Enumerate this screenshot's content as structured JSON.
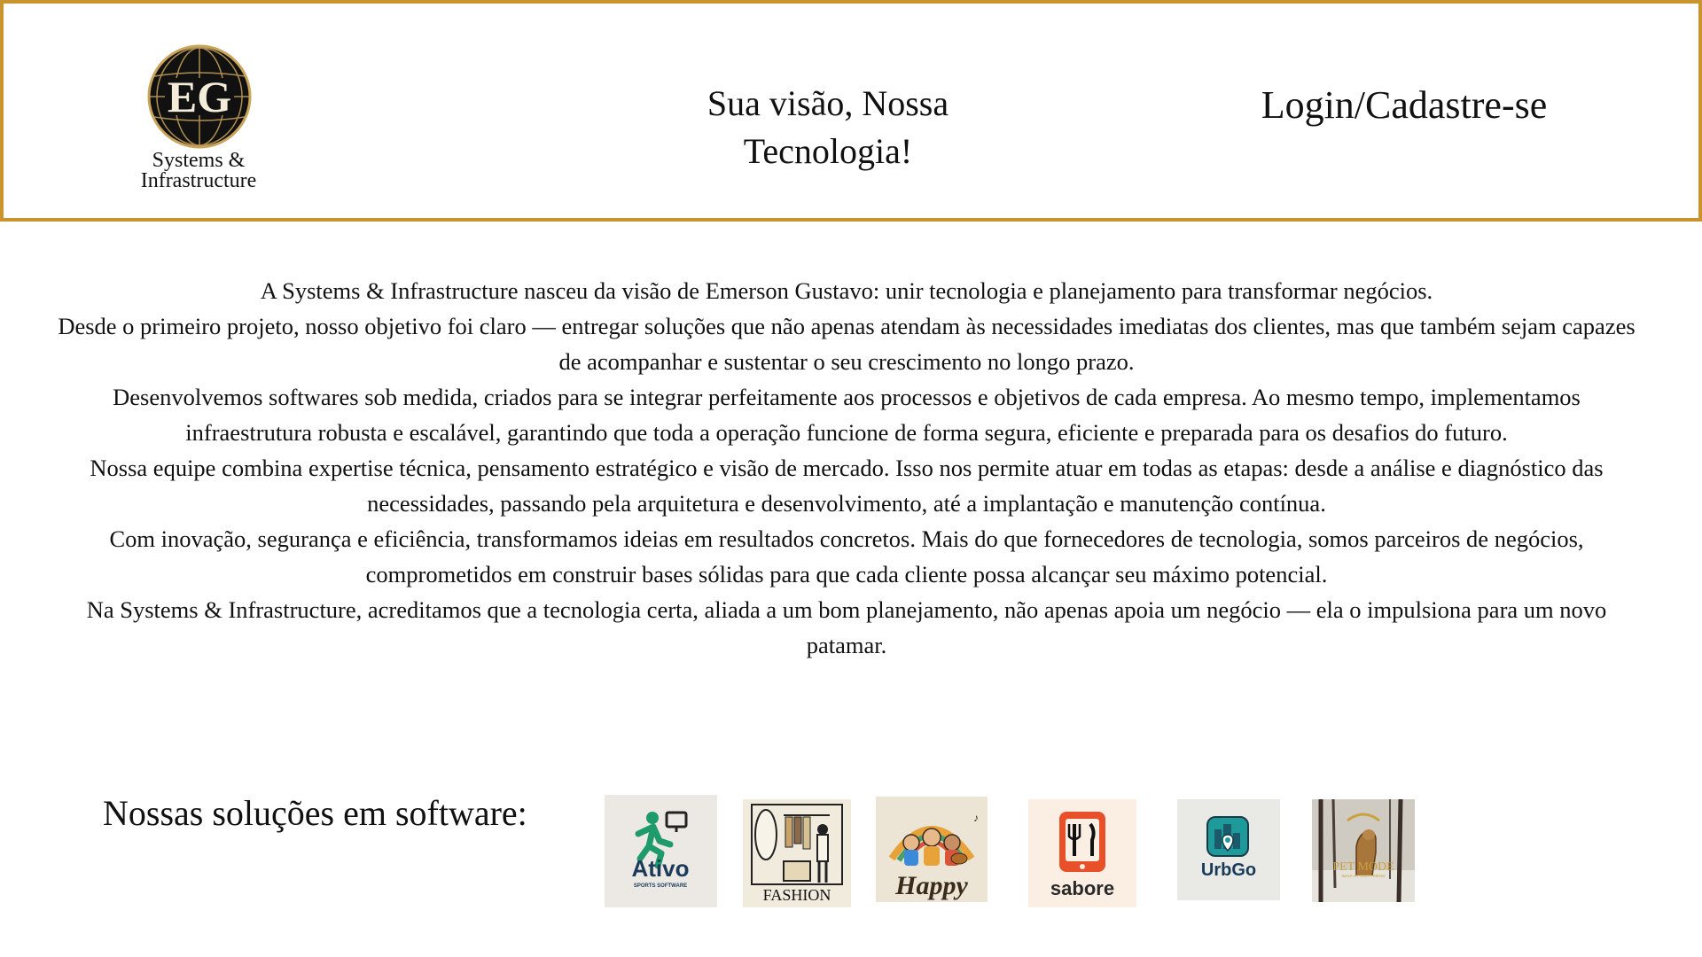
{
  "header": {
    "logo": {
      "monogram": "EG",
      "line1": "Systems &",
      "line2": "Infrastructure"
    },
    "tagline_line1": "Sua visão, Nossa",
    "tagline_line2": "Tecnologia!",
    "login_label": "Login/Cadastre-se"
  },
  "about": {
    "paragraphs": [
      "A Systems & Infrastructure nasceu da visão de Emerson Gustavo: unir tecnologia e planejamento para transformar negócios.",
      "Desde o primeiro projeto, nosso objetivo foi claro — entregar soluções que não apenas atendam às necessidades imediatas dos clientes, mas que também sejam capazes de acompanhar e sustentar o seu crescimento no longo prazo.",
      "Desenvolvemos softwares sob medida, criados para se integrar perfeitamente aos processos e objetivos de cada empresa. Ao mesmo tempo, implementamos infraestrutura robusta e escalável, garantindo que toda a operação funcione de forma segura, eficiente e preparada para os desafios do futuro.",
      "Nossa equipe combina expertise técnica, pensamento estratégico e visão de mercado. Isso nos permite atuar em todas as etapas: desde a análise e diagnóstico das necessidades, passando pela arquitetura e desenvolvimento, até a implantação e manutenção contínua.",
      "Com inovação, segurança e eficiência, transformamos ideias em resultados concretos. Mais do que fornecedores de tecnologia, somos parceiros de negócios, comprometidos em construir bases sólidas para que cada cliente possa alcançar seu máximo potencial.",
      "Na Systems & Infrastructure, acreditamos que a tecnologia certa, aliada a um bom planejamento, não apenas apoia um negócio — ela o impulsiona para um novo patamar."
    ]
  },
  "solutions": {
    "title": "Nossas soluções em software:",
    "apps": [
      {
        "name": "Ativo",
        "subtitle": "SPORTS SOFTWARE",
        "icon": "running-person-monitor-icon",
        "color": "#1f9a6b"
      },
      {
        "name": "FASHION",
        "icon": "wardrobe-mirror-icon",
        "color": "#2a2a2a"
      },
      {
        "name": "Happy",
        "icon": "kids-music-icon",
        "color": "#3a2a1a"
      },
      {
        "name": "sabore",
        "icon": "fork-knife-phone-icon",
        "color": "#e8502a"
      },
      {
        "name": "UrbGo",
        "icon": "city-map-pin-icon",
        "color": "#1f7a8a"
      },
      {
        "name": "PET MODE",
        "subtitle": "WALK BY DOG FRIEND",
        "icon": "dog-in-forest-icon",
        "color": "#c9a23a"
      }
    ]
  },
  "colors": {
    "header_border": "#c9932e",
    "logo_gold": "#c9a45a",
    "logo_black": "#111111"
  }
}
